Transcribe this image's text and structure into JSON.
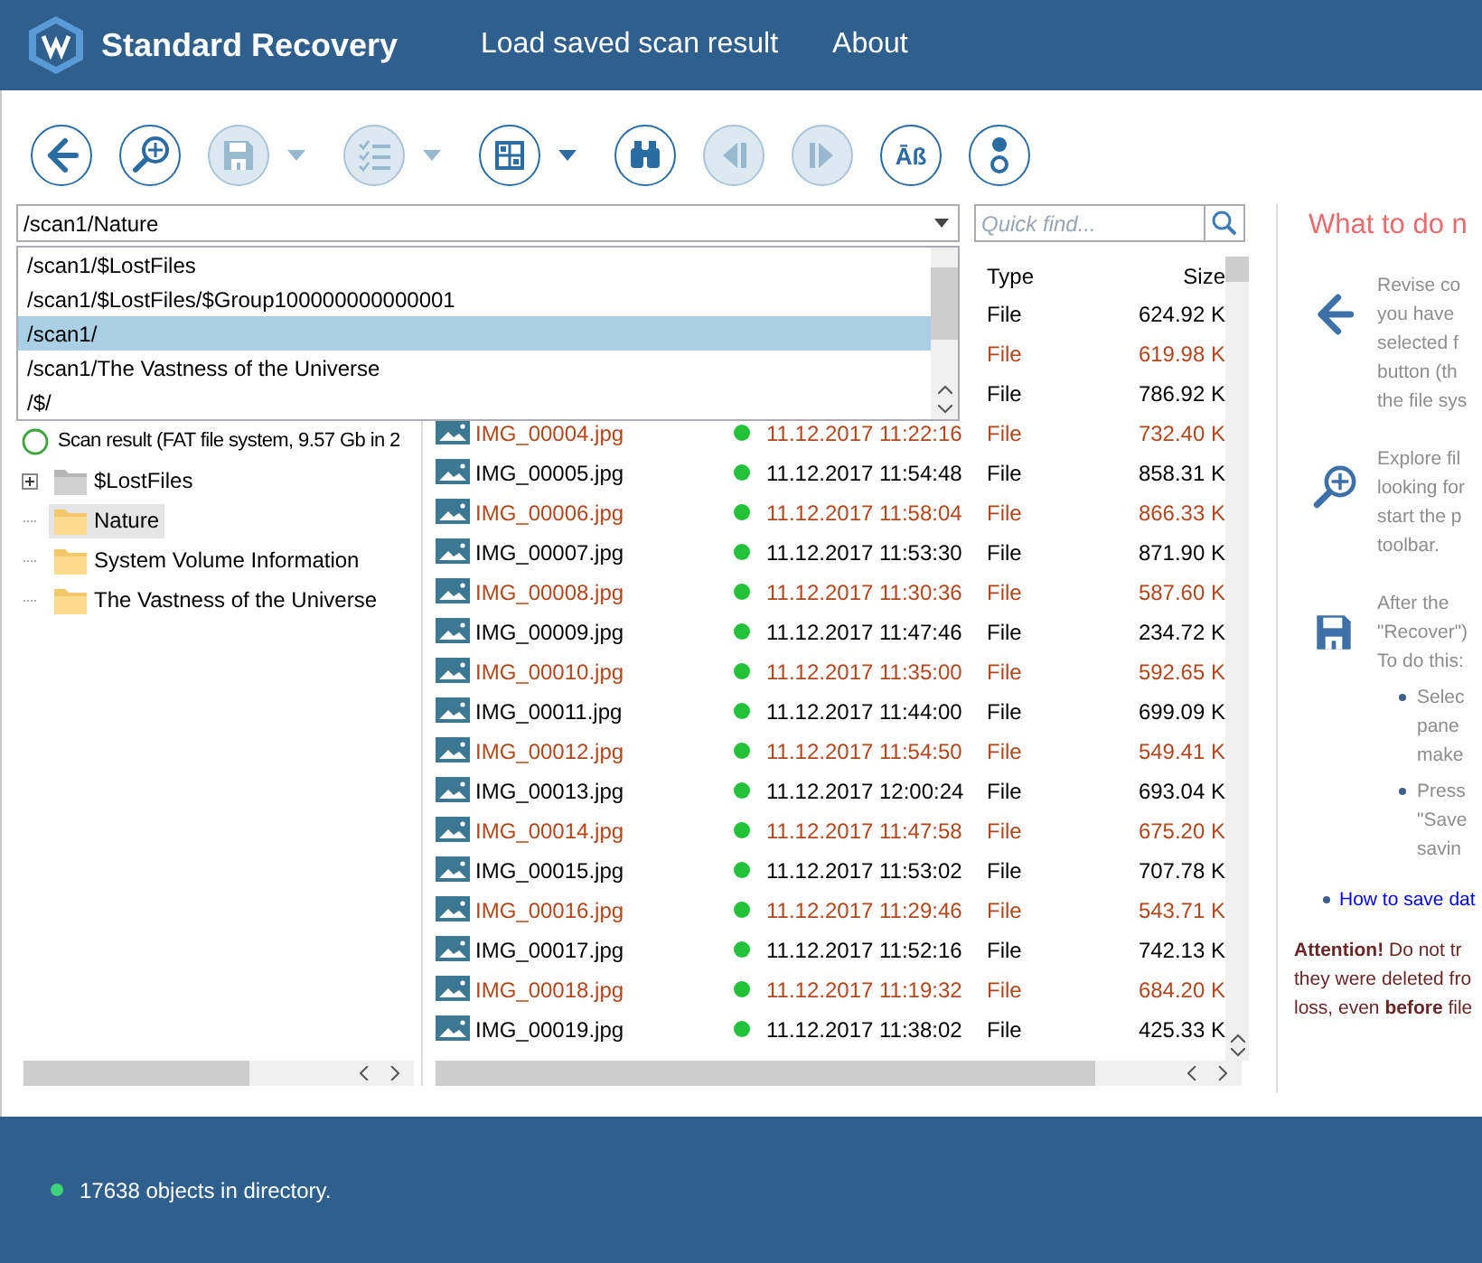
{
  "header": {
    "title": "Standard Recovery",
    "menu": [
      {
        "label": "Load saved scan result"
      },
      {
        "label": "About"
      }
    ]
  },
  "toolbar": [
    {
      "kind": "back",
      "disabled": false,
      "menu": false
    },
    {
      "kind": "explore",
      "disabled": false,
      "menu": false
    },
    {
      "kind": "save",
      "disabled": true,
      "menu": true
    },
    {
      "kind": "checklist",
      "disabled": true,
      "menu": true
    },
    {
      "kind": "view",
      "disabled": false,
      "menu": true
    },
    {
      "kind": "find",
      "disabled": false,
      "menu": false
    },
    {
      "kind": "previous",
      "disabled": true,
      "menu": false
    },
    {
      "kind": "next",
      "disabled": true,
      "menu": false
    },
    {
      "kind": "encoding",
      "disabled": false,
      "menu": false,
      "label": "Āß"
    },
    {
      "kind": "info",
      "disabled": false,
      "menu": false
    }
  ],
  "path": {
    "value": "/scan1/Nature",
    "options": [
      {
        "label": "/scan1/$LostFiles",
        "selected": false
      },
      {
        "label": "/scan1/$LostFiles/$Group100000000000001",
        "selected": false
      },
      {
        "label": "/scan1/",
        "selected": true
      },
      {
        "label": "/scan1/The Vastness of the Universe",
        "selected": false
      },
      {
        "label": "/$/",
        "selected": false
      }
    ]
  },
  "quick_find": {
    "placeholder": "Quick find..."
  },
  "tree": {
    "root": {
      "label": "Scan result (FAT file system, 9.57 Gb in 2",
      "children": [
        {
          "label": "$LostFiles",
          "kind": "virtual",
          "expandable": true,
          "selected": false
        },
        {
          "label": "Nature",
          "kind": "folder",
          "expandable": false,
          "selected": true
        },
        {
          "label": "System Volume Information",
          "kind": "folder",
          "expandable": false,
          "selected": false
        },
        {
          "label": "The Vastness of the Universe",
          "kind": "folder",
          "expandable": false,
          "selected": false
        }
      ]
    }
  },
  "file_list": {
    "columns": [
      {
        "label": "Type"
      },
      {
        "label": "Size"
      }
    ],
    "rows": [
      {
        "type": "File",
        "size": "624.92 K",
        "highlighted": false
      },
      {
        "type": "File",
        "size": "619.98 K",
        "highlighted": true
      },
      {
        "type": "File",
        "size": "786.92 K",
        "highlighted": false
      },
      {
        "name": "IMG_00004.jpg",
        "date": "11.12.2017 11:22:16",
        "type": "File",
        "size": "732.40 K",
        "highlighted": true
      },
      {
        "name": "IMG_00005.jpg",
        "date": "11.12.2017 11:54:48",
        "type": "File",
        "size": "858.31 K",
        "highlighted": false
      },
      {
        "name": "IMG_00006.jpg",
        "date": "11.12.2017 11:58:04",
        "type": "File",
        "size": "866.33 K",
        "highlighted": true
      },
      {
        "name": "IMG_00007.jpg",
        "date": "11.12.2017 11:53:30",
        "type": "File",
        "size": "871.90 K",
        "highlighted": false
      },
      {
        "name": "IMG_00008.jpg",
        "date": "11.12.2017 11:30:36",
        "type": "File",
        "size": "587.60 K",
        "highlighted": true
      },
      {
        "name": "IMG_00009.jpg",
        "date": "11.12.2017 11:47:46",
        "type": "File",
        "size": "234.72 K",
        "highlighted": false
      },
      {
        "name": "IMG_00010.jpg",
        "date": "11.12.2017 11:35:00",
        "type": "File",
        "size": "592.65 K",
        "highlighted": true
      },
      {
        "name": "IMG_00011.jpg",
        "date": "11.12.2017 11:44:00",
        "type": "File",
        "size": "699.09 K",
        "highlighted": false
      },
      {
        "name": "IMG_00012.jpg",
        "date": "11.12.2017 11:54:50",
        "type": "File",
        "size": "549.41 K",
        "highlighted": true
      },
      {
        "name": "IMG_00013.jpg",
        "date": "11.12.2017 12:00:24",
        "type": "File",
        "size": "693.04 K",
        "highlighted": false
      },
      {
        "name": "IMG_00014.jpg",
        "date": "11.12.2017 11:47:58",
        "type": "File",
        "size": "675.20 K",
        "highlighted": true
      },
      {
        "name": "IMG_00015.jpg",
        "date": "11.12.2017 11:53:02",
        "type": "File",
        "size": "707.78 K",
        "highlighted": false
      },
      {
        "name": "IMG_00016.jpg",
        "date": "11.12.2017 11:29:46",
        "type": "File",
        "size": "543.71 K",
        "highlighted": true
      },
      {
        "name": "IMG_00017.jpg",
        "date": "11.12.2017 11:52:16",
        "type": "File",
        "size": "742.13 K",
        "highlighted": false
      },
      {
        "name": "IMG_00018.jpg",
        "date": "11.12.2017 11:19:32",
        "type": "File",
        "size": "684.20 K",
        "highlighted": true
      },
      {
        "name": "IMG_00019.jpg",
        "date": "11.12.2017 11:38:02",
        "type": "File",
        "size": "425.33 K",
        "highlighted": false
      }
    ]
  },
  "help": {
    "title": "What to do n",
    "blocks": [
      {
        "kind": "back",
        "lines": [
          "Revise co",
          "you have",
          "selected f",
          "button (th",
          "the file sys"
        ]
      },
      {
        "kind": "explore",
        "lines": [
          "Explore fil",
          "looking for",
          "start the p",
          "toolbar."
        ]
      },
      {
        "kind": "save",
        "lines": [
          "After the",
          "\"Recover\")",
          "To do this:"
        ],
        "bullets": [
          {
            "lines": [
              "Selec",
              "pane",
              "make"
            ]
          },
          {
            "lines": [
              "Press",
              "\"Save",
              "savin"
            ]
          }
        ]
      }
    ],
    "link": "How to save dat",
    "attention": [
      "**Attention!** Do not tr",
      "they were deleted fro",
      "loss, even **before** file"
    ]
  },
  "status_bar": {
    "text": "17638 objects in directory."
  }
}
